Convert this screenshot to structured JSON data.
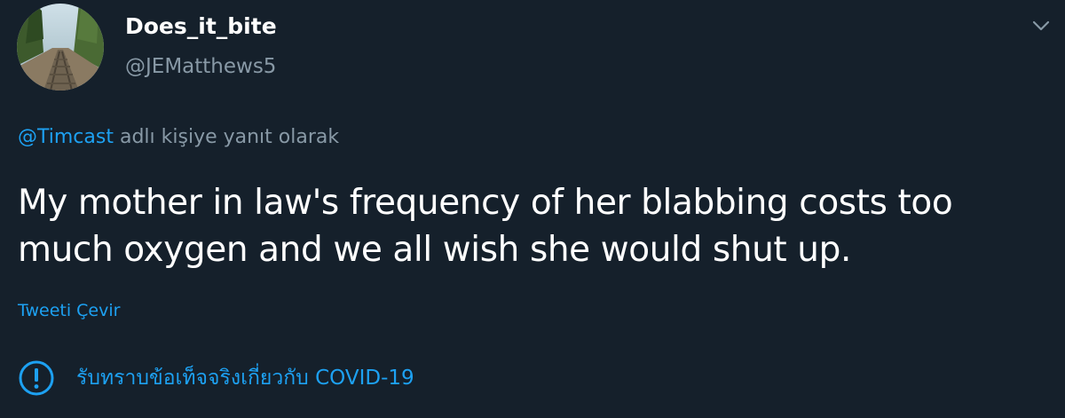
{
  "tweet": {
    "display_name": "Does_it_bite",
    "handle": "@JEMatthews5",
    "reply_mention": "@Timcast",
    "reply_suffix": " adlı kişiye yanıt olarak",
    "text": "My mother in law's frequency of her blabbing costs too much oxygen and we all wish she would shut up.",
    "translate_label": "Tweeti Çevir",
    "covid_notice": "รับทราบข้อเท็จจริงเกี่ยวกับ COVID-19"
  },
  "icons": {
    "menu": "chevron-down-icon",
    "covid": "info-exclamation-icon",
    "avatar": "avatar"
  },
  "colors": {
    "background": "#15202b",
    "primary_text": "#ffffff",
    "secondary_text": "#8899a6",
    "accent": "#1da1f2"
  }
}
